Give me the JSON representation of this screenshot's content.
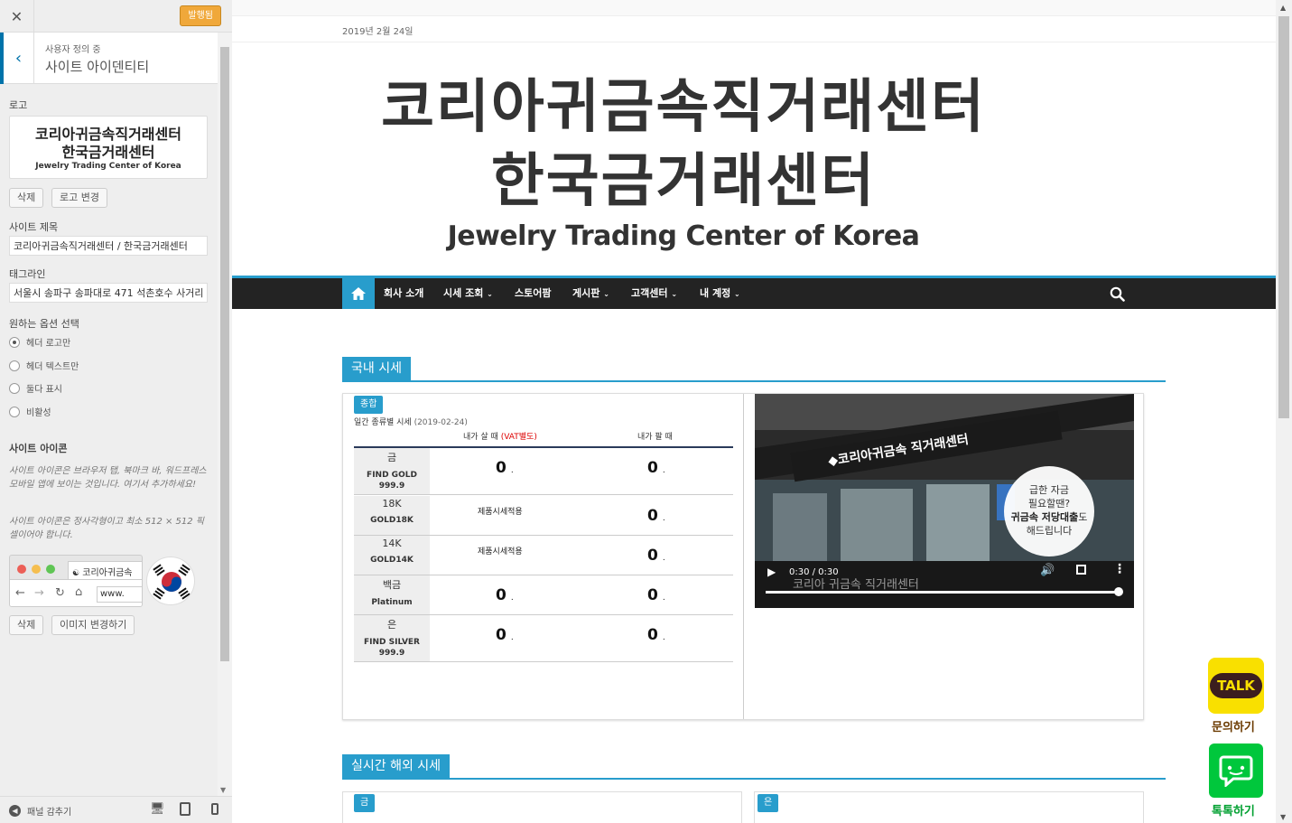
{
  "customizer": {
    "close_icon": "close-icon",
    "publish_label": "발행됨",
    "breadcrumb": "사용자 정의 중",
    "section_title": "사이트 아이덴티티",
    "logo_label": "로고",
    "logo_preview": {
      "line1": "코리아귀금속직거래센터",
      "line2": "한국금거래센터",
      "line3": "Jewelry Trading Center of Korea"
    },
    "remove_label": "삭제",
    "change_logo_label": "로고 변경",
    "site_title_label": "사이트 제목",
    "site_title_value": "코리아귀금속직거래센터 / 한국금거래센터",
    "tagline_label": "태그라인",
    "tagline_value": "서울시 송파구 송파대로 471 석촌호수 사거리",
    "options_label": "원하는 옵션 선택",
    "options": [
      {
        "label": "헤더 로고만",
        "selected": true
      },
      {
        "label": "헤더 텍스트만",
        "selected": false
      },
      {
        "label": "둘다 표시",
        "selected": false
      },
      {
        "label": "비활성",
        "selected": false
      }
    ],
    "site_icon_label": "사이트 아이콘",
    "site_icon_desc1": "사이트 아이콘은 브라우저 탭, 북마크 바, 워드프레스 모바일 앱에 보이는 것입니다. 여기서 추가하세요!",
    "site_icon_desc2": "사이트 아이콘은 정사각형이고 최소 512 × 512 픽셀이어야 합니다.",
    "browser_tab_text": "코리아귀금속",
    "browser_url": "www.",
    "change_image_label": "이미지 변경하기",
    "hide_panel_label": "패널 감추기"
  },
  "site": {
    "date": "2019년 2월 24일",
    "logo": {
      "line1": "코리아귀금속직거래센터",
      "line2": "한국금거래센터",
      "line3": "Jewelry Trading Center of Korea"
    },
    "nav": [
      "회사 소개",
      "시세 조회",
      "스토어팜",
      "게시판",
      "고객센터",
      "내 계정"
    ],
    "domestic_title": "국내 시세",
    "overseas_title": "실시간 해외 시세"
  },
  "prices": {
    "badge": "종합",
    "subtitle": "일간 종류별 시세",
    "subtitle_date": "(2019-02-24)",
    "buy_header": "내가 살 때",
    "buy_header_note": "(VAT별도)",
    "sell_header": "내가 팔 때",
    "rows": [
      {
        "name_ko": "금",
        "name_en": "FIND GOLD",
        "name_en2": "999.9",
        "buy": "0",
        "buy_note": "",
        "sell": "0"
      },
      {
        "name_ko": "18K",
        "name_en": "GOLD18K",
        "name_en2": "",
        "buy": "",
        "buy_note": "제품시세적용",
        "sell": "0"
      },
      {
        "name_ko": "14K",
        "name_en": "GOLD14K",
        "name_en2": "",
        "buy": "",
        "buy_note": "제품시세적용",
        "sell": "0"
      },
      {
        "name_ko": "백금",
        "name_en": "Platinum",
        "name_en2": "",
        "buy": "0",
        "buy_note": "",
        "sell": "0"
      },
      {
        "name_ko": "은",
        "name_en": "FIND SILVER",
        "name_en2": "999.9",
        "buy": "0",
        "buy_note": "",
        "sell": "0"
      }
    ],
    "unit_suffix": "."
  },
  "video": {
    "sign_text": "◆코리아귀금속 직거래센터",
    "bubble_line1": "급한 자금",
    "bubble_line2": "필요할땐?",
    "bubble_line3_bold": "귀금속 저당대출",
    "bubble_line3_tail": "도",
    "bubble_line4": "해드립니다",
    "time": "0:30 / 0:30",
    "caption": "코리아 귀금속 직거래센터"
  },
  "overseas": {
    "gold_badge": "금",
    "silver_badge": "은"
  },
  "floating": {
    "kakao_badge": "TALK",
    "kakao_label": "문의하기",
    "talk_label": "톡톡하기"
  },
  "colors": {
    "accent": "#289dcc",
    "nav_bg": "#232323",
    "publish": "#f0a83a",
    "kakao": "#f9e000",
    "naver": "#00c73c"
  }
}
